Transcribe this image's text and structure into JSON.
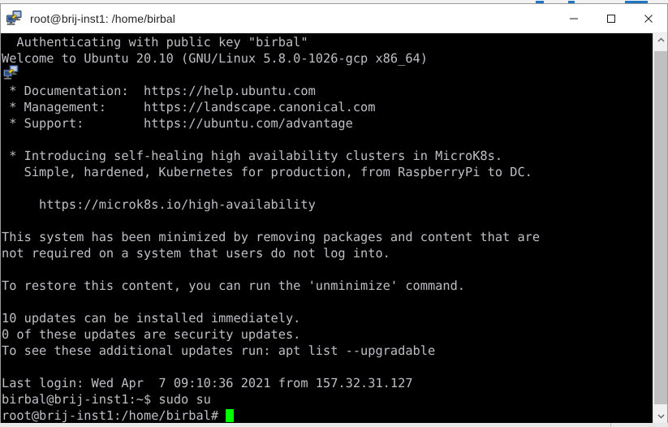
{
  "window": {
    "title": "root@brij-inst1: /home/birbal",
    "app_icon": "putty-icon",
    "controls": {
      "minimize": "minimize-icon",
      "maximize": "maximize-icon",
      "close": "close-icon"
    }
  },
  "terminal": {
    "background_color": "#000000",
    "foreground_color": "#bfbfc6",
    "cursor_color": "#00ff00",
    "lines": [
      "  Authenticating with public key \"birbal\"",
      "Welcome to Ubuntu 20.10 (GNU/Linux 5.8.0-1026-gcp x86_64)",
      "",
      " * Documentation:  https://help.ubuntu.com",
      " * Management:     https://landscape.canonical.com",
      " * Support:        https://ubuntu.com/advantage",
      "",
      " * Introducing self-healing high availability clusters in MicroK8s.",
      "   Simple, hardened, Kubernetes for production, from RaspberryPi to DC.",
      "",
      "     https://microk8s.io/high-availability",
      "",
      "This system has been minimized by removing packages and content that are",
      "not required on a system that users do not log into.",
      "",
      "To restore this content, you can run the 'unminimize' command.",
      "",
      "10 updates can be installed immediately.",
      "0 of these updates are security updates.",
      "To see these additional updates run: apt list --upgradable",
      "",
      "Last login: Wed Apr  7 09:10:36 2021 from 157.32.31.127",
      "birbal@brij-inst1:~$ sudo su"
    ],
    "prompt": "root@brij-inst1:/home/birbal# ",
    "cursor": "block-cursor"
  },
  "scrollbar": {
    "up_arrow": "chevron-up-icon",
    "down_arrow": "chevron-down-icon",
    "thumb": "scrollbar-thumb"
  }
}
